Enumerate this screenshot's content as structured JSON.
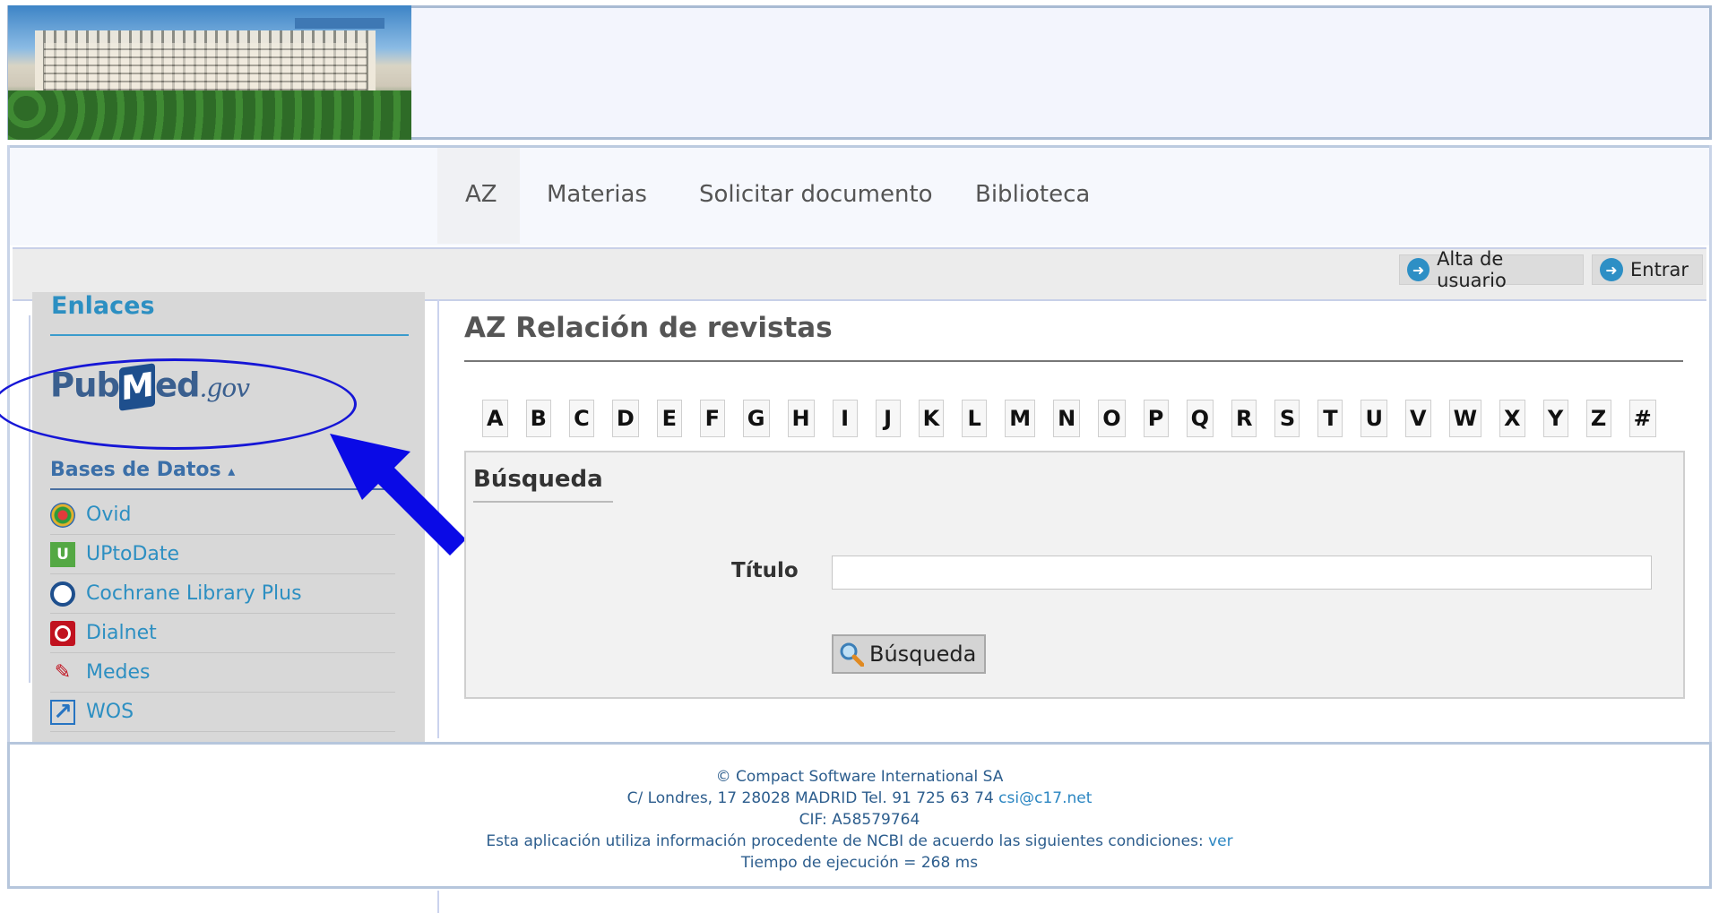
{
  "header": {
    "logo_alt": "Hospital building"
  },
  "nav": {
    "items": [
      "AZ",
      "Materias",
      "Solicitar documento",
      "Biblioteca"
    ]
  },
  "userbar": {
    "register_label": "Alta de usuario",
    "login_label": "Entrar"
  },
  "sidebar": {
    "title": "Enlaces",
    "pubmed": {
      "pub": "Pub",
      "m": "M",
      "ed": "ed",
      "gov": ".gov"
    },
    "databases_title": "Bases de Datos",
    "databases_caret": "▴",
    "databases": [
      {
        "label": "Ovid",
        "icon": "ovid-icon"
      },
      {
        "label": "UPtoDate",
        "icon": "uptodate-icon"
      },
      {
        "label": "Cochrane Library Plus",
        "icon": "cochrane-icon"
      },
      {
        "label": "Dialnet",
        "icon": "dialnet-icon"
      },
      {
        "label": "Medes",
        "icon": "medes-icon"
      },
      {
        "label": "WOS",
        "icon": "external-link-icon"
      }
    ]
  },
  "main": {
    "title": "AZ Relación de revistas",
    "letters": [
      "A",
      "B",
      "C",
      "D",
      "E",
      "F",
      "G",
      "H",
      "I",
      "J",
      "K",
      "L",
      "M",
      "N",
      "O",
      "P",
      "Q",
      "R",
      "S",
      "T",
      "U",
      "V",
      "W",
      "X",
      "Y",
      "Z",
      "#"
    ],
    "search": {
      "title": "Búsqueda",
      "field_label": "Título",
      "field_value": "",
      "button_label": "Búsqueda"
    }
  },
  "footer": {
    "line1": "© Compact Software International SA",
    "line2_text": "C/ Londres, 17 28028 MADRID Tel. 91 725 63 74",
    "line2_email": "csi@c17.net",
    "line3": "CIF: A58579764",
    "line4_text": "Esta aplicación utiliza información procedente de NCBI de acuerdo las siguientes condiciones:",
    "line4_link": "ver",
    "line5": "Tiempo de ejecución = 268 ms"
  },
  "colors": {
    "accent": "#2c8fc2",
    "annotation_blue": "#1616d6"
  }
}
